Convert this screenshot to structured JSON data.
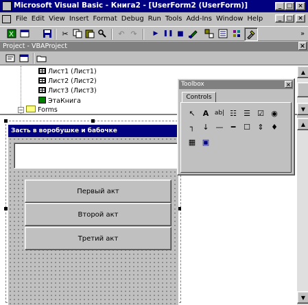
{
  "app": {
    "title": "Microsoft Visual Basic - Книга2 - [UserForm2 (UserForm)]",
    "window_buttons": [
      "_",
      "□",
      "×"
    ],
    "mdi_buttons": [
      "_",
      "□",
      "×"
    ]
  },
  "menu": {
    "items": [
      "File",
      "Edit",
      "View",
      "Insert",
      "Format",
      "Debug",
      "Run",
      "Tools",
      "Add-Ins",
      "Window",
      "Help"
    ]
  },
  "project_panel": {
    "title": "Project - VBAProject",
    "close": "×",
    "items": [
      {
        "label": "Лист1 (Лист1)",
        "icon": "sheet-icon"
      },
      {
        "label": "Лист2 (Лист2)",
        "icon": "sheet-icon"
      },
      {
        "label": "Лист3 (Лист3)",
        "icon": "sheet-icon"
      },
      {
        "label": "ЭтаКнига",
        "icon": "workbook-icon"
      },
      {
        "label": "Forms",
        "icon": "folder-icon"
      }
    ]
  },
  "toolbox": {
    "title": "Toolbox",
    "close": "×",
    "tab": "Controls",
    "tools_row1": [
      "↖",
      "A",
      "ab|",
      "☷",
      "☰",
      "☑",
      "◉"
    ],
    "tools_row2": [
      "┐",
      "↓",
      "—",
      "━",
      "☐",
      "⇕",
      "♦"
    ],
    "tools_row3": [
      "▦",
      "▣"
    ]
  },
  "userform": {
    "caption": "Засть в воробушке и бабочке",
    "textbox_value": "",
    "buttons": [
      "Первый акт",
      "Второй акт",
      "Третий акт"
    ]
  },
  "colors": {
    "titlebar": "#000080",
    "face": "#c0c0c0",
    "workspace": "#808080"
  }
}
